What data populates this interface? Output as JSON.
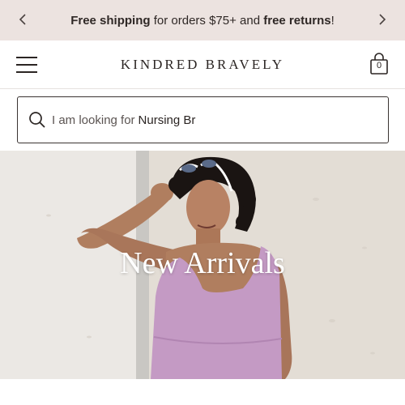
{
  "announcement": {
    "part1_bold": "Free shipping",
    "part2": " for orders $75+ and ",
    "part3_bold": "free returns",
    "part4": "!",
    "prev_icon": "chevron-left-icon",
    "next_icon": "chevron-right-icon"
  },
  "header": {
    "brand": "KINDRED BRAVELY",
    "menu_icon": "hamburger-menu-icon",
    "cart_icon": "shopping-bag-icon",
    "cart_count": "0"
  },
  "search": {
    "icon": "search-icon",
    "placeholder_prefix": "I am looking for",
    "typed_text": "Nursing Br"
  },
  "hero": {
    "headline": "New Arrivals"
  },
  "colors": {
    "announcement_bg": "#ece3e0",
    "text_dark": "#2b2523",
    "dress_lilac": "#c49ac4"
  }
}
